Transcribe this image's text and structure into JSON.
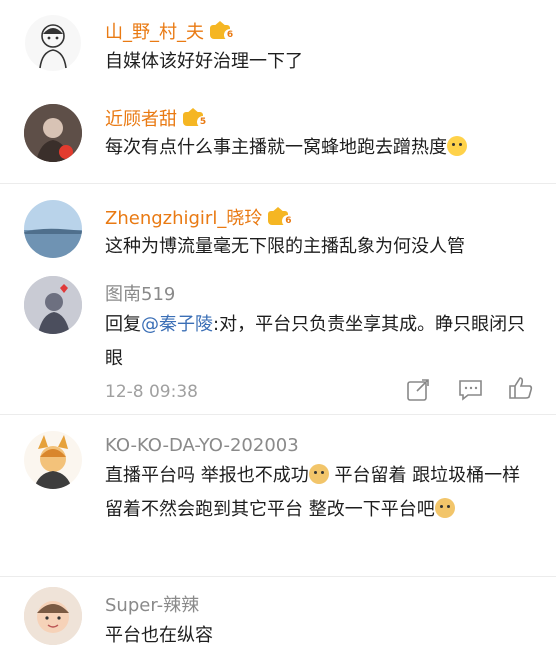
{
  "comments": [
    {
      "name": "山_野_村_夫",
      "vip_level": "6",
      "text": "自媒体该好好治理一下了"
    },
    {
      "name": "近顾者甜",
      "vip_level": "5",
      "text": "每次有点什么事主播就一窝蜂地跑去蹭热度",
      "emoji": "crying-face-emoji"
    },
    {
      "name": "Zhengzhigirl_晓玲",
      "vip_level": "6",
      "text": "这种为博流量毫无下限的主播乱象为何没人管"
    },
    {
      "name": "图南519",
      "reply_prefix": "回复",
      "reply_to": "@秦子陵",
      "reply_text": ":对，平台只负责坐享其成。睁只眼闭只眼",
      "time": "12-8 09:38"
    },
    {
      "name": "KO-KO-DA-YO-202003",
      "text_part1": "直播平台吗 举报也不成功",
      "text_part2": " 平台留着 跟垃圾桶一样留着不然会跑到其它平台 整改一下平台吧"
    },
    {
      "name": "Super-辣辣",
      "text": "平台也在纵容"
    }
  ],
  "icons": {
    "share": "share-icon",
    "comment": "comment-icon",
    "like": "like-icon"
  },
  "colors": {
    "vip_name": "#e97a13",
    "normal_name": "#8a8a8a",
    "link": "#3b6fb6"
  }
}
